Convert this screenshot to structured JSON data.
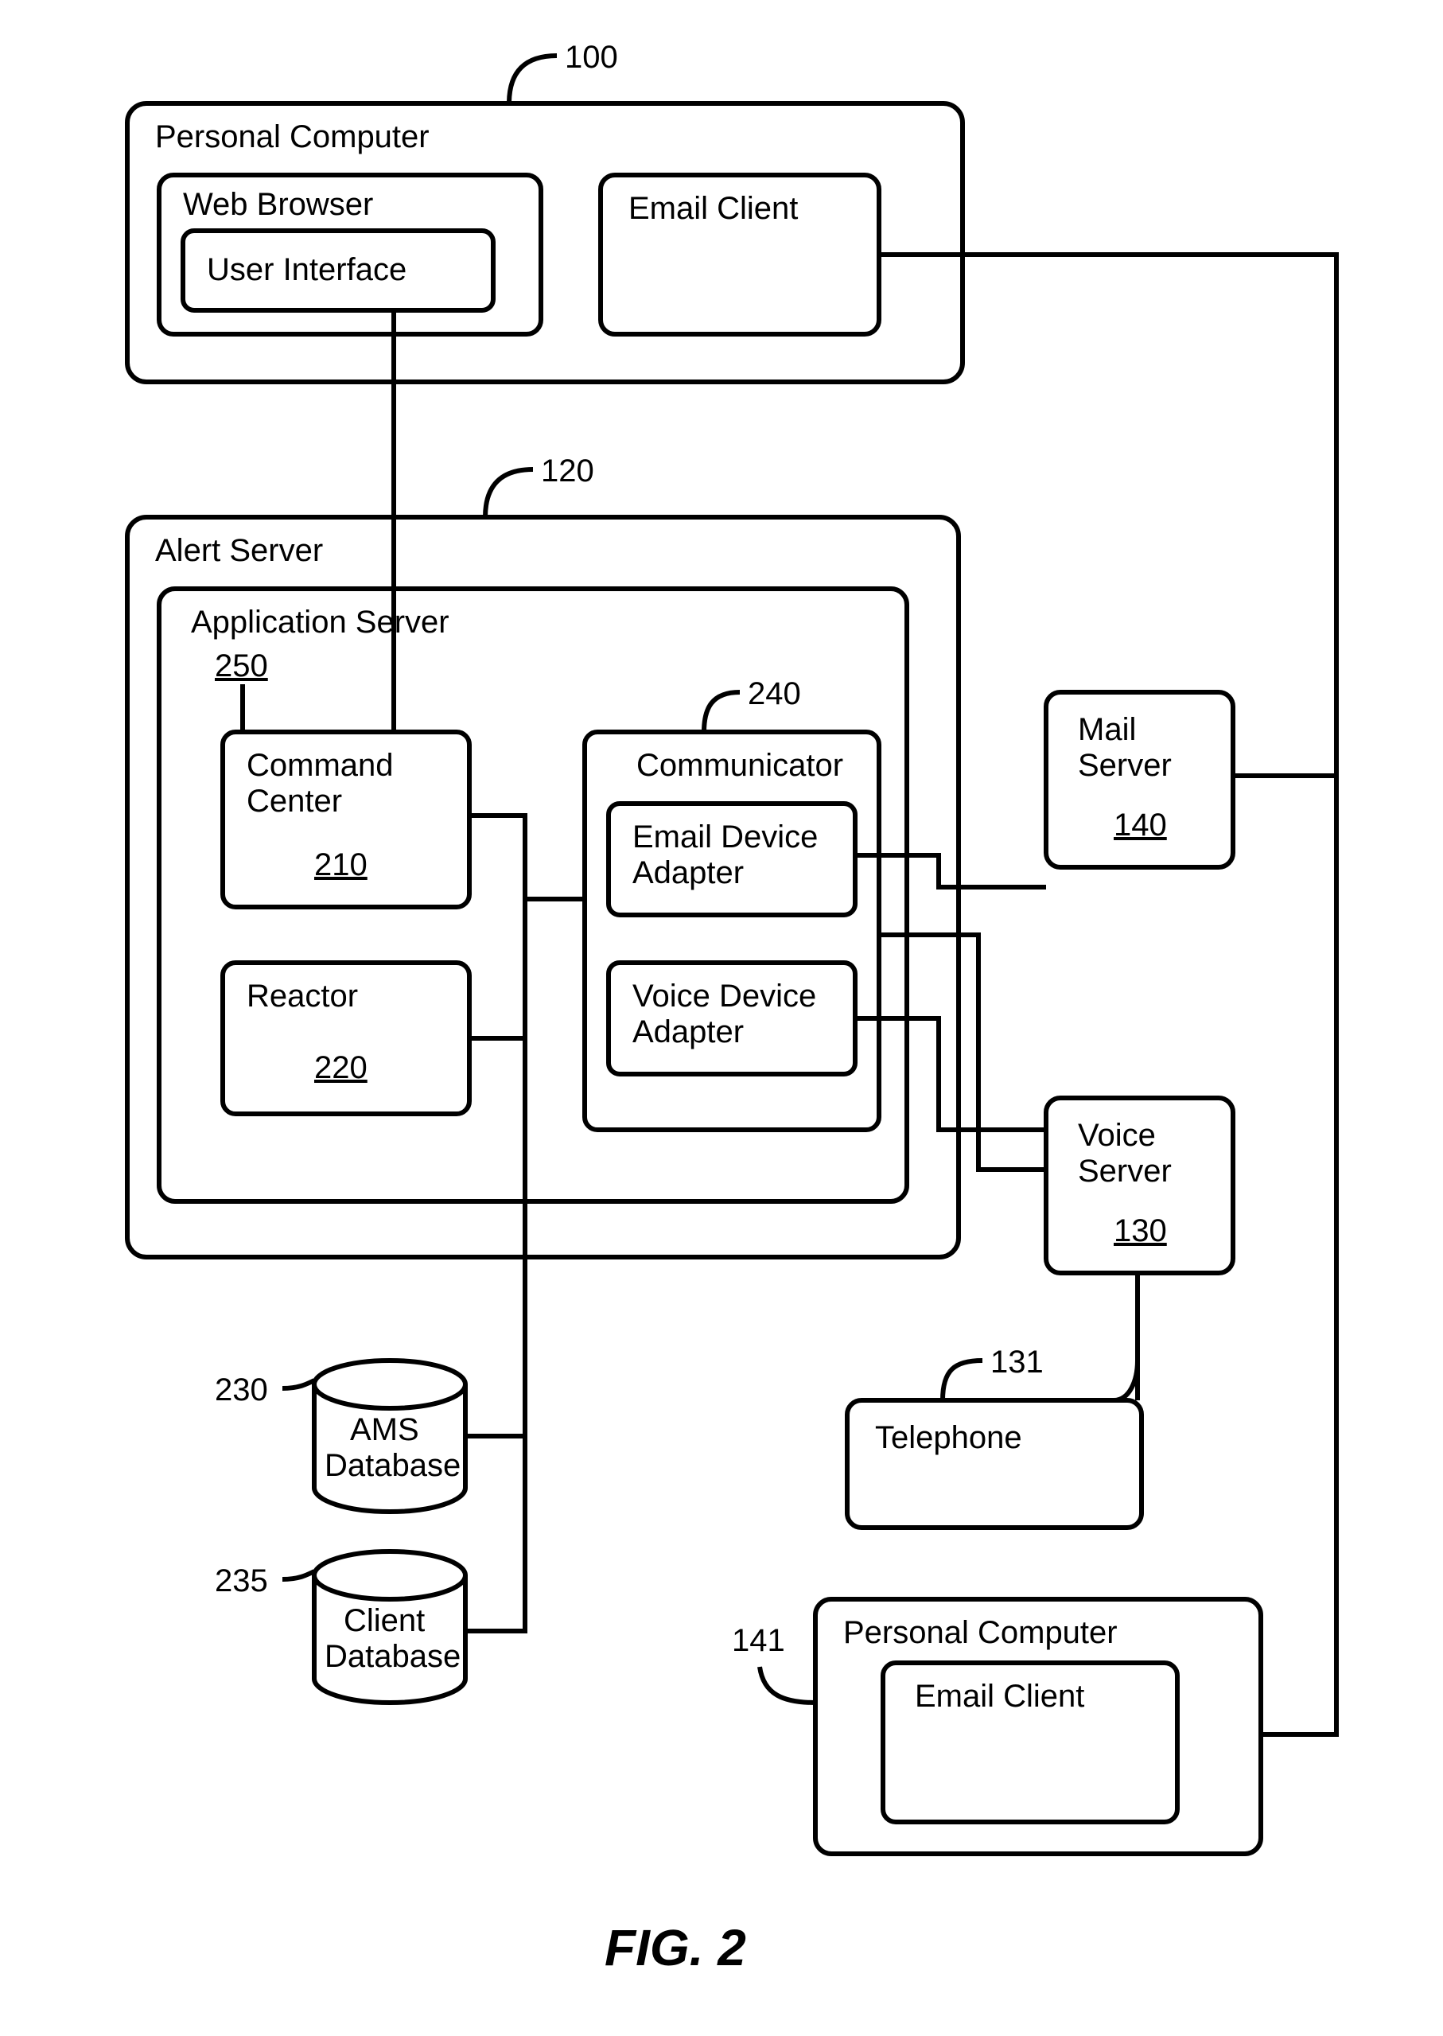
{
  "figure_label": "FIG. 2",
  "pc1": {
    "title": "Personal Computer",
    "ref": "100",
    "web_browser": "Web Browser",
    "user_interface": "User Interface",
    "email_client": "Email Client"
  },
  "alert_server": {
    "title": "Alert Server",
    "ref": "120",
    "app_server": {
      "title": "Application Server",
      "ref": "250",
      "command_center": {
        "title": "Command\nCenter",
        "ref": "210"
      },
      "reactor": {
        "title": "Reactor",
        "ref": "220"
      },
      "communicator": {
        "title": "Communicator",
        "ref": "240",
        "email_adapter": "Email Device\nAdapter",
        "voice_adapter": "Voice Device\nAdapter"
      }
    }
  },
  "mail_server": {
    "title": "Mail\nServer",
    "ref": "140"
  },
  "voice_server": {
    "title": "Voice\nServer",
    "ref": "130"
  },
  "ams_db": {
    "title": "AMS\nDatabase",
    "ref": "230"
  },
  "client_db": {
    "title": "Client\nDatabase",
    "ref": "235"
  },
  "telephone": {
    "title": "Telephone",
    "ref": "131"
  },
  "pc2": {
    "title": "Personal Computer",
    "ref": "141",
    "email_client": "Email Client"
  }
}
